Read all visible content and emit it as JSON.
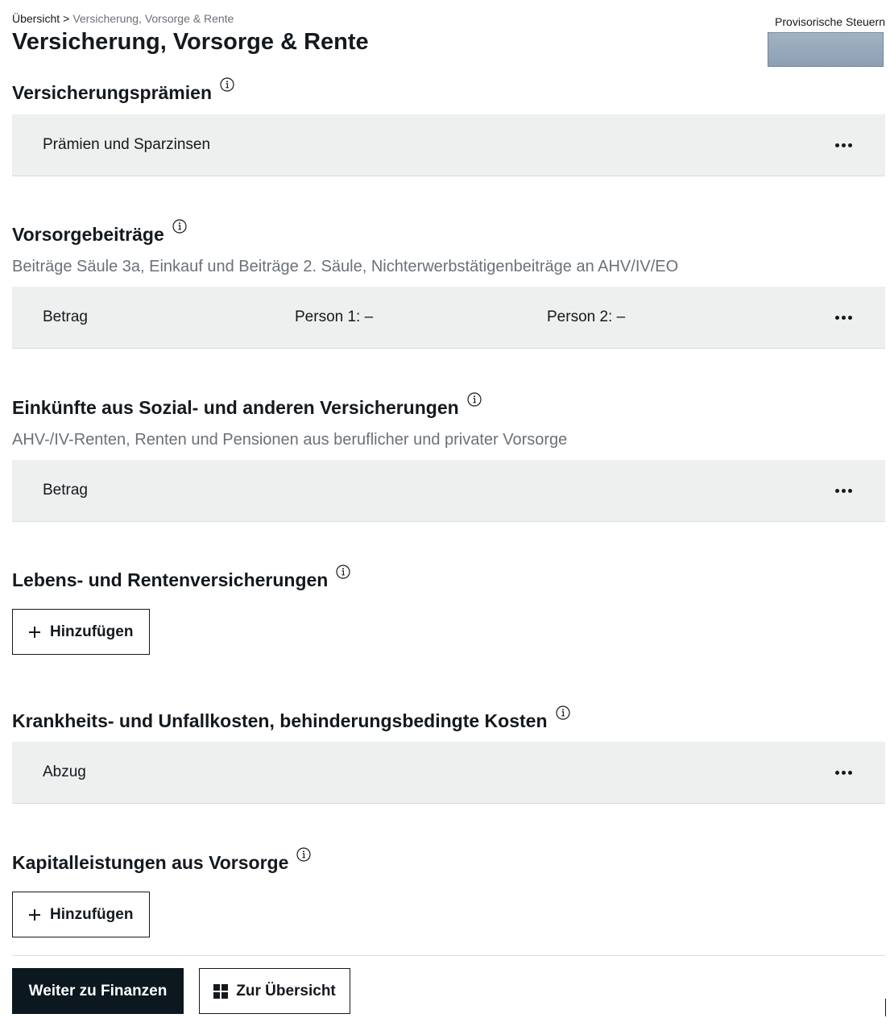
{
  "breadcrumb": {
    "home": "Übersicht",
    "separator": ">",
    "current": "Versicherung, Vorsorge & Rente"
  },
  "page_title": "Versicherung, Vorsorge & Rente",
  "provisional": {
    "label": "Provisorische Steuern"
  },
  "sections": {
    "praemien": {
      "title": "Versicherungsprämien",
      "row_label": "Prämien und Sparzinsen"
    },
    "vorsorge": {
      "title": "Vorsorgebeiträge",
      "subtitle": "Beiträge Säule 3a, Einkauf und Beiträge 2. Säule, Nichterwerbstätigenbeiträge an AHV/IV/EO",
      "row_label": "Betrag",
      "person1": "Person 1: –",
      "person2": "Person 2: –"
    },
    "einkuenfte": {
      "title": "Einkünfte aus Sozial- und anderen Versicherungen",
      "subtitle": "AHV-/IV-Renten, Renten und Pensionen aus beruflicher und privater Vorsorge",
      "row_label": "Betrag"
    },
    "lebens": {
      "title": "Lebens- und Rentenversicherungen",
      "add_label": "Hinzufügen"
    },
    "krankheit": {
      "title": "Krankheits- und Unfallkosten, behinderungsbedingte Kosten",
      "row_label": "Abzug"
    },
    "kapital": {
      "title": "Kapitalleistungen aus Vorsorge",
      "add_label": "Hinzufügen"
    }
  },
  "footer": {
    "primary_label": "Weiter zu Finanzen",
    "secondary_label": "Zur Übersicht"
  },
  "icons": {
    "info": "info-icon",
    "menu": "more-dots-icon",
    "add": "plus-icon",
    "overview": "grid-icon"
  },
  "colors": {
    "row_background": "#eeefef",
    "primary_button": "#0c1820",
    "muted_text": "#6b7178",
    "provisional_bar": "#97a9bc"
  }
}
